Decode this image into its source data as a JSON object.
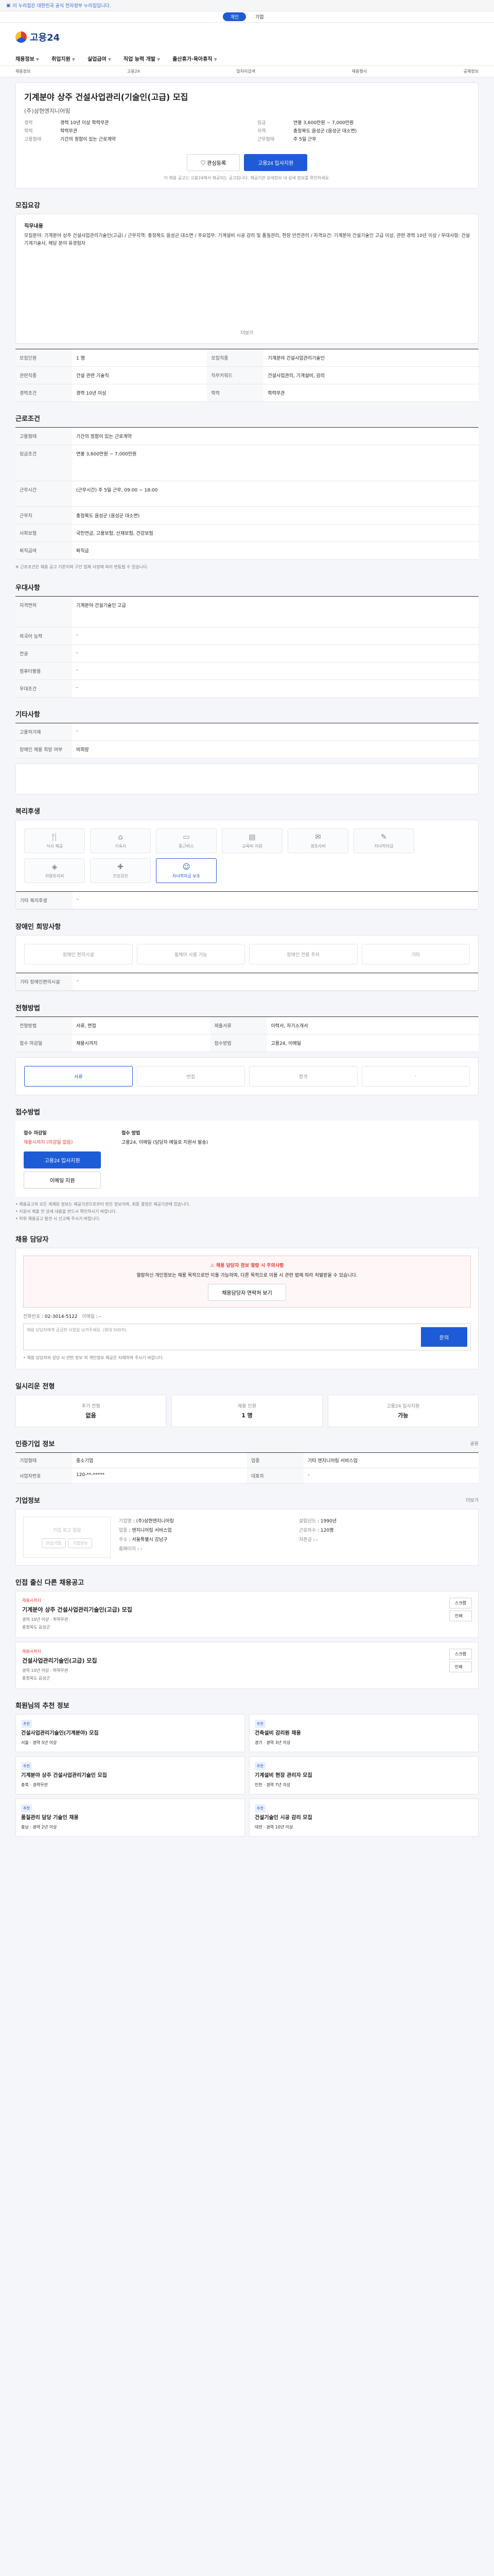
{
  "top": {
    "notice": "이 누리집은 대한민국 공식 전자정부 누리집입니다."
  },
  "gnb": {
    "items": [
      "개인",
      "기업"
    ]
  },
  "logo": {
    "text": "고용24"
  },
  "nav": [
    "채용정보",
    "취업지원",
    "실업급여",
    "직업 능력 개발",
    "출산휴가·육아휴직"
  ],
  "subnav": [
    "채용정보",
    "고용24",
    "일자리검색",
    "채용행사",
    "공채정보"
  ],
  "job": {
    "title": "기계분야 상주 건설사업관리(기술인(고급) 모집",
    "company": "(주)삼현엔지니어링",
    "recruiting": "채용시까지",
    "left": [
      {
        "k": "경력",
        "v": "경력 10년 이상 학력무관"
      },
      {
        "k": "학력",
        "v": "학력무관"
      },
      {
        "k": "고용형태",
        "v": "기간의 정함이 있는 근로계약"
      }
    ],
    "right": [
      {
        "k": "임금",
        "v": "연봉 3,600만원 ~ 7,000만원"
      },
      {
        "k": "지역",
        "v": "충청북도 음성군 (음성군 대소면)"
      },
      {
        "k": "근무형태",
        "v": "주 5일 근무"
      }
    ],
    "btn_like": "관심등록",
    "btn_apply": "고용24 입사지원",
    "note": "이 채용 공고는 고용24에서 제공되는 공고입니다. 제공기관 상세정보 내 상세 정보를 확인하세요."
  },
  "sec": {
    "detail": "모집요강",
    "conditions": "근로조건",
    "welfare": "우대사항",
    "others": "기타사항",
    "benefits": "복리후생",
    "disability": "장애인 희망사항",
    "process": "전형방법",
    "apply": "접수방법",
    "contact": "채용 담당자",
    "nearby": "일시리운 전형",
    "info": "인증기업 정보",
    "company": "기업정보",
    "similar": "인접 출신 다른 채용공고",
    "more": "회원님의 추천 정보"
  },
  "detail": {
    "job_desc_title": "직무내용",
    "job_desc": "모집분야: 기계분야 상주 건설사업관리기술인(고급) / 근무지역: 충청북도 음성군 대소면 / 주요업무: 기계설비 시공 감리 및 품질관리, 현장 안전관리 / 자격요건: 기계분야 건설기술인 고급 이상, 관련 경력 10년 이상 / 우대사항: 건설기계기술사, 해당 분야 유경험자",
    "rows": [
      {
        "k": "모집인원",
        "v": "1 명"
      },
      {
        "k": "모집직종",
        "v": "기계분야 건설사업관리기술인"
      },
      {
        "k": "관련직종",
        "v": "건설 관련 기술직"
      },
      {
        "k": "직무키워드",
        "v": "건설사업관리, 기계설비, 감리"
      },
      {
        "k": "경력조건",
        "v": "경력 10년 이상"
      },
      {
        "k": "학력",
        "v": "학력무관"
      }
    ]
  },
  "cond": {
    "rows": [
      {
        "k": "고용형태",
        "v": "기간의 정함이 있는 근로계약"
      },
      {
        "k": "임금조건",
        "v": "연봉 3,600만원 ~ 7,000만원"
      },
      {
        "k": "근무시간",
        "v": "(근무시간) 주 5일 근무, 09:00 ~ 18:00"
      },
      {
        "k": "근무지",
        "v": "충청북도 음성군 (음성군 대소면)"
      },
      {
        "k": "사회보험",
        "v": "국민연금, 고용보험, 산재보험, 건강보험"
      },
      {
        "k": "퇴직급여",
        "v": "퇴직금"
      }
    ],
    "note": "※ 근로조건은 채용 공고 기준이며 구인 업체 사정에 따라 변동될 수 있습니다."
  },
  "welfare_rows": [
    {
      "k": "자격면허",
      "v": "기계분야 건설기술인 고급"
    },
    {
      "k": "외국어 능력",
      "v": "-"
    },
    {
      "k": "전공",
      "v": "-"
    },
    {
      "k": "컴퓨터활용",
      "v": "-"
    },
    {
      "k": "우대조건",
      "v": "-"
    }
  ],
  "others_rows": [
    {
      "k": "고용허가제",
      "v": "-"
    },
    {
      "k": "장애인 채용 희망 여부",
      "v": "비희망"
    }
  ],
  "benefits": {
    "items": [
      "식사 제공",
      "기숙사",
      "통근버스",
      "교육비 지원",
      "경조사비",
      "자녀학자금",
      "차량유지비",
      "건강검진",
      "자녀학자금 보조"
    ],
    "active_index": 8,
    "extra_label": "기타 복리후생",
    "extra": "-"
  },
  "disability": {
    "items": [
      "장애인 편의시설",
      "휠체어 사용 가능",
      "장애인 전용 주차",
      "기타"
    ],
    "extra_label": "기타 장애인편의시설",
    "extra": "-"
  },
  "process": {
    "rows": [
      {
        "k": "전형방법",
        "v": "서류, 면접"
      },
      {
        "k": "제출서류",
        "v": "이력서, 자기소개서"
      },
      {
        "k": "접수 마감일",
        "v": "채용시까지"
      },
      {
        "k": "접수방법",
        "v": "고용24, 이메일"
      }
    ],
    "steps": [
      "서류",
      "면접",
      "합격",
      "-"
    ]
  },
  "apply": {
    "label": "접수 마감일",
    "deadline": "채용시까지 (마감일 없음)",
    "btn": "고용24 입사지원",
    "btn2": "이메일 지원",
    "method_label": "접수 방법",
    "method": "고용24, 이메일 (담당자 메일로 지원서 발송)",
    "bullets": [
      "• 채용공고의 모든 게재된 정보는 제공기관으로부터 받은 정보이며, 최종 결정은 제공기관에 있습니다.",
      "• 지원서 제출 전 상세 내용을 반드시 확인하시기 바랍니다.",
      "• 허위 채용공고 발견 시 신고해 주시기 바랍니다."
    ]
  },
  "contact": {
    "alert_title": "채용 담당자 정보 열람 시 주의사항",
    "alert": "열람하신 개인정보는 채용 목적으로만 이용 가능하며, 다른 목적으로 이용 시 관련 법에 따라 처벌받을 수 있습니다.",
    "btn_view": "채용담당자 연락처 보기",
    "phone_label": "전화번호",
    "phone": "02-3014-5122",
    "email_label": "이메일",
    "email": "-",
    "textarea": "채용 담당자에게 궁금한 사항을 남겨주세요. (최대 500자)",
    "send": "문의",
    "bullet": "• 채용 담당자와 상담 시 관련 정보 외 개인정보 제공은 자제하여 주시기 바랍니다."
  },
  "nearby": [
    {
      "k": "추가 전형",
      "v": "없음"
    },
    {
      "k": "채용 인원",
      "v": "1 명"
    },
    {
      "k": "고용24 입사지원",
      "v": "가능"
    }
  ],
  "info": {
    "rows": [
      {
        "k": "기업형태",
        "v": "중소기업"
      },
      {
        "k": "업종",
        "v": "기타 엔지니어링 서비스업"
      },
      {
        "k": "사업자번호",
        "v": "120-**-*****"
      },
      {
        "k": "대표자",
        "v": "-"
      }
    ]
  },
  "company": {
    "logo_label": "기업 로고 없음",
    "rows": [
      {
        "k": "기업명",
        "v": "(주)삼현엔지니어링"
      },
      {
        "k": "업종",
        "v": "엔지니어링 서비스업"
      },
      {
        "k": "주소",
        "v": "서울특별시 강남구"
      },
      {
        "k": "홈페이지",
        "v": "-"
      }
    ],
    "stats": [
      {
        "k": "설립년도",
        "v": "1990년"
      },
      {
        "k": "근로자수",
        "v": "120명"
      },
      {
        "k": "자본금",
        "v": "-"
      }
    ],
    "btn1": "관심기업",
    "btn2": "기업정보"
  },
  "similar": [
    {
      "tag": "채용시까지",
      "name": "기계분야 상주 건설사업관리기술인(고급) 모집",
      "meta1": "경력 10년 이상 · 학력무관",
      "meta2": "충청북도 음성군"
    },
    {
      "tag": "채용시까지",
      "name": "건설사업관리기술인(고급) 모집",
      "meta1": "경력 10년 이상 · 학력무관",
      "meta2": "충청북도 음성군"
    }
  ],
  "recommend": [
    {
      "badge": "추천",
      "name": "건설사업관리기술인(기계분야) 모집",
      "meta": "서울 · 경력 5년 이상"
    },
    {
      "badge": "추천",
      "name": "건축설비 감리원 채용",
      "meta": "경기 · 경력 3년 이상"
    },
    {
      "badge": "추천",
      "name": "기계분야 상주 건설사업관리기술인 모집",
      "meta": "충북 · 경력무관"
    },
    {
      "badge": "추천",
      "name": "기계설비 현장 관리자 모집",
      "meta": "인천 · 경력 7년 이상"
    },
    {
      "badge": "추천",
      "name": "품질관리 담당 기술인 채용",
      "meta": "충남 · 경력 2년 이상"
    },
    {
      "badge": "추천",
      "name": "건설기술인 시공 감리 모집",
      "meta": "대전 · 경력 10년 이상"
    }
  ],
  "labels": {
    "more": "더보기",
    "share": "공유",
    "scrap": "스크랩",
    "print": "인쇄"
  }
}
